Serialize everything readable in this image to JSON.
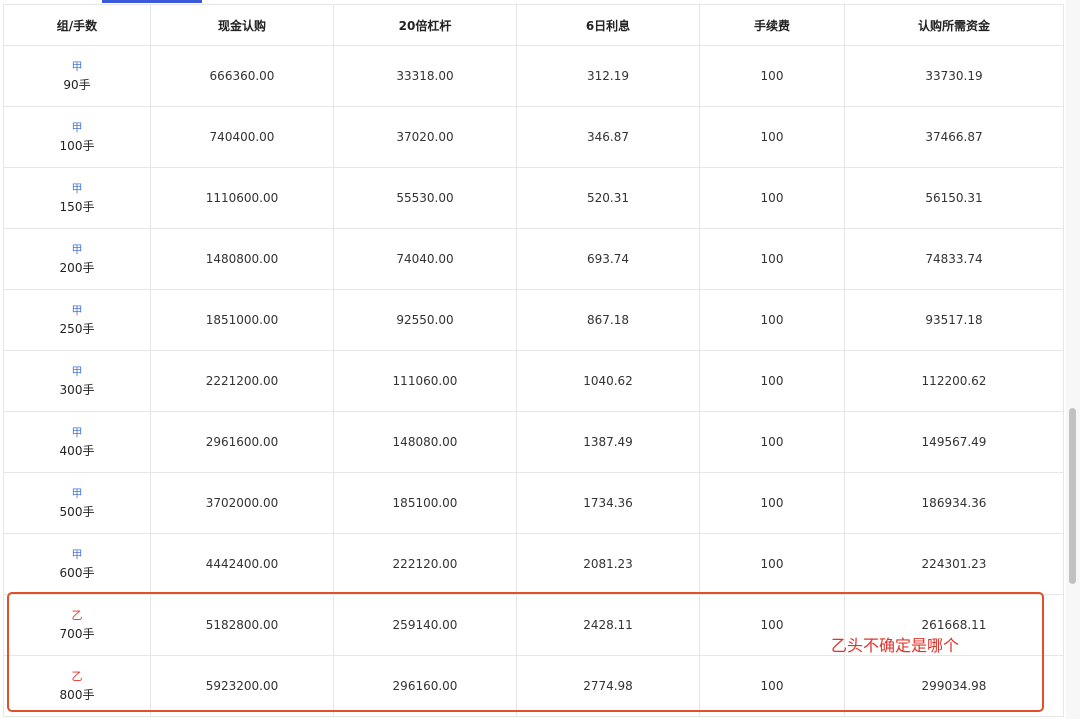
{
  "table": {
    "headers": [
      "组/手数",
      "现金认购",
      "20倍杠杆",
      "6日利息",
      "手续费",
      "认购所需资金"
    ],
    "rows": [
      {
        "group": "甲",
        "lots": "90手",
        "cash": "666360.00",
        "leverage": "33318.00",
        "interest": "312.19",
        "fee": "100",
        "required": "33730.19"
      },
      {
        "group": "甲",
        "lots": "100手",
        "cash": "740400.00",
        "leverage": "37020.00",
        "interest": "346.87",
        "fee": "100",
        "required": "37466.87"
      },
      {
        "group": "甲",
        "lots": "150手",
        "cash": "1110600.00",
        "leverage": "55530.00",
        "interest": "520.31",
        "fee": "100",
        "required": "56150.31"
      },
      {
        "group": "甲",
        "lots": "200手",
        "cash": "1480800.00",
        "leverage": "74040.00",
        "interest": "693.74",
        "fee": "100",
        "required": "74833.74"
      },
      {
        "group": "甲",
        "lots": "250手",
        "cash": "1851000.00",
        "leverage": "92550.00",
        "interest": "867.18",
        "fee": "100",
        "required": "93517.18"
      },
      {
        "group": "甲",
        "lots": "300手",
        "cash": "2221200.00",
        "leverage": "111060.00",
        "interest": "1040.62",
        "fee": "100",
        "required": "112200.62"
      },
      {
        "group": "甲",
        "lots": "400手",
        "cash": "2961600.00",
        "leverage": "148080.00",
        "interest": "1387.49",
        "fee": "100",
        "required": "149567.49"
      },
      {
        "group": "甲",
        "lots": "500手",
        "cash": "3702000.00",
        "leverage": "185100.00",
        "interest": "1734.36",
        "fee": "100",
        "required": "186934.36"
      },
      {
        "group": "甲",
        "lots": "600手",
        "cash": "4442400.00",
        "leverage": "222120.00",
        "interest": "2081.23",
        "fee": "100",
        "required": "224301.23"
      },
      {
        "group": "乙",
        "lots": "700手",
        "cash": "5182800.00",
        "leverage": "259140.00",
        "interest": "2428.11",
        "fee": "100",
        "required": "261668.11"
      },
      {
        "group": "乙",
        "lots": "800手",
        "cash": "5923200.00",
        "leverage": "296160.00",
        "interest": "2774.98",
        "fee": "100",
        "required": "299034.98"
      }
    ]
  },
  "annotation": {
    "text": "乙头不确定是哪个"
  },
  "colors": {
    "group_a": "#4a78d8",
    "group_b": "#e0322b",
    "highlight_border": "#e0502a",
    "annotation": "#e0322b",
    "grid_line": "#e6e6e6"
  }
}
